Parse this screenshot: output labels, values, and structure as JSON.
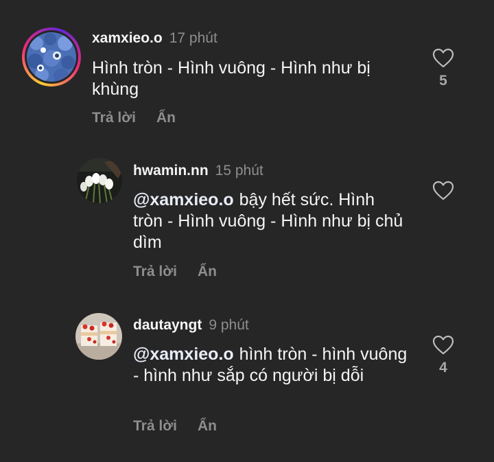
{
  "comments": [
    {
      "username": "xamxieo.o",
      "time": "17 phút",
      "mention": "",
      "text": "Hình tròn - Hình vuông - Hình như bị khùng",
      "reply_label": "Trả lời",
      "hide_label": "Ẩn",
      "likes": "5",
      "has_story_ring": true
    },
    {
      "username": "hwamin.nn",
      "time": "15 phút",
      "mention": "@xamxieo.o",
      "text": "bậy hết sức. Hình tròn - Hình vuông - Hình như bị chủ dìm",
      "reply_label": "Trả lời",
      "hide_label": "Ẩn",
      "likes": "",
      "has_story_ring": false
    },
    {
      "username": "dautayngt",
      "time": "9 phút",
      "mention": "@xamxieo.o",
      "text": "hình tròn - hình vuông - hình như sắp có người bị dỗi",
      "reply_label": "Trả lời",
      "hide_label": "Ẩn",
      "likes": "4",
      "has_story_ring": false
    }
  ],
  "colors": {
    "background": "#262626",
    "primary_text": "#f5f5f5",
    "secondary_text": "#8e8e8e"
  },
  "icons": {
    "like": "heart-outline-icon"
  }
}
